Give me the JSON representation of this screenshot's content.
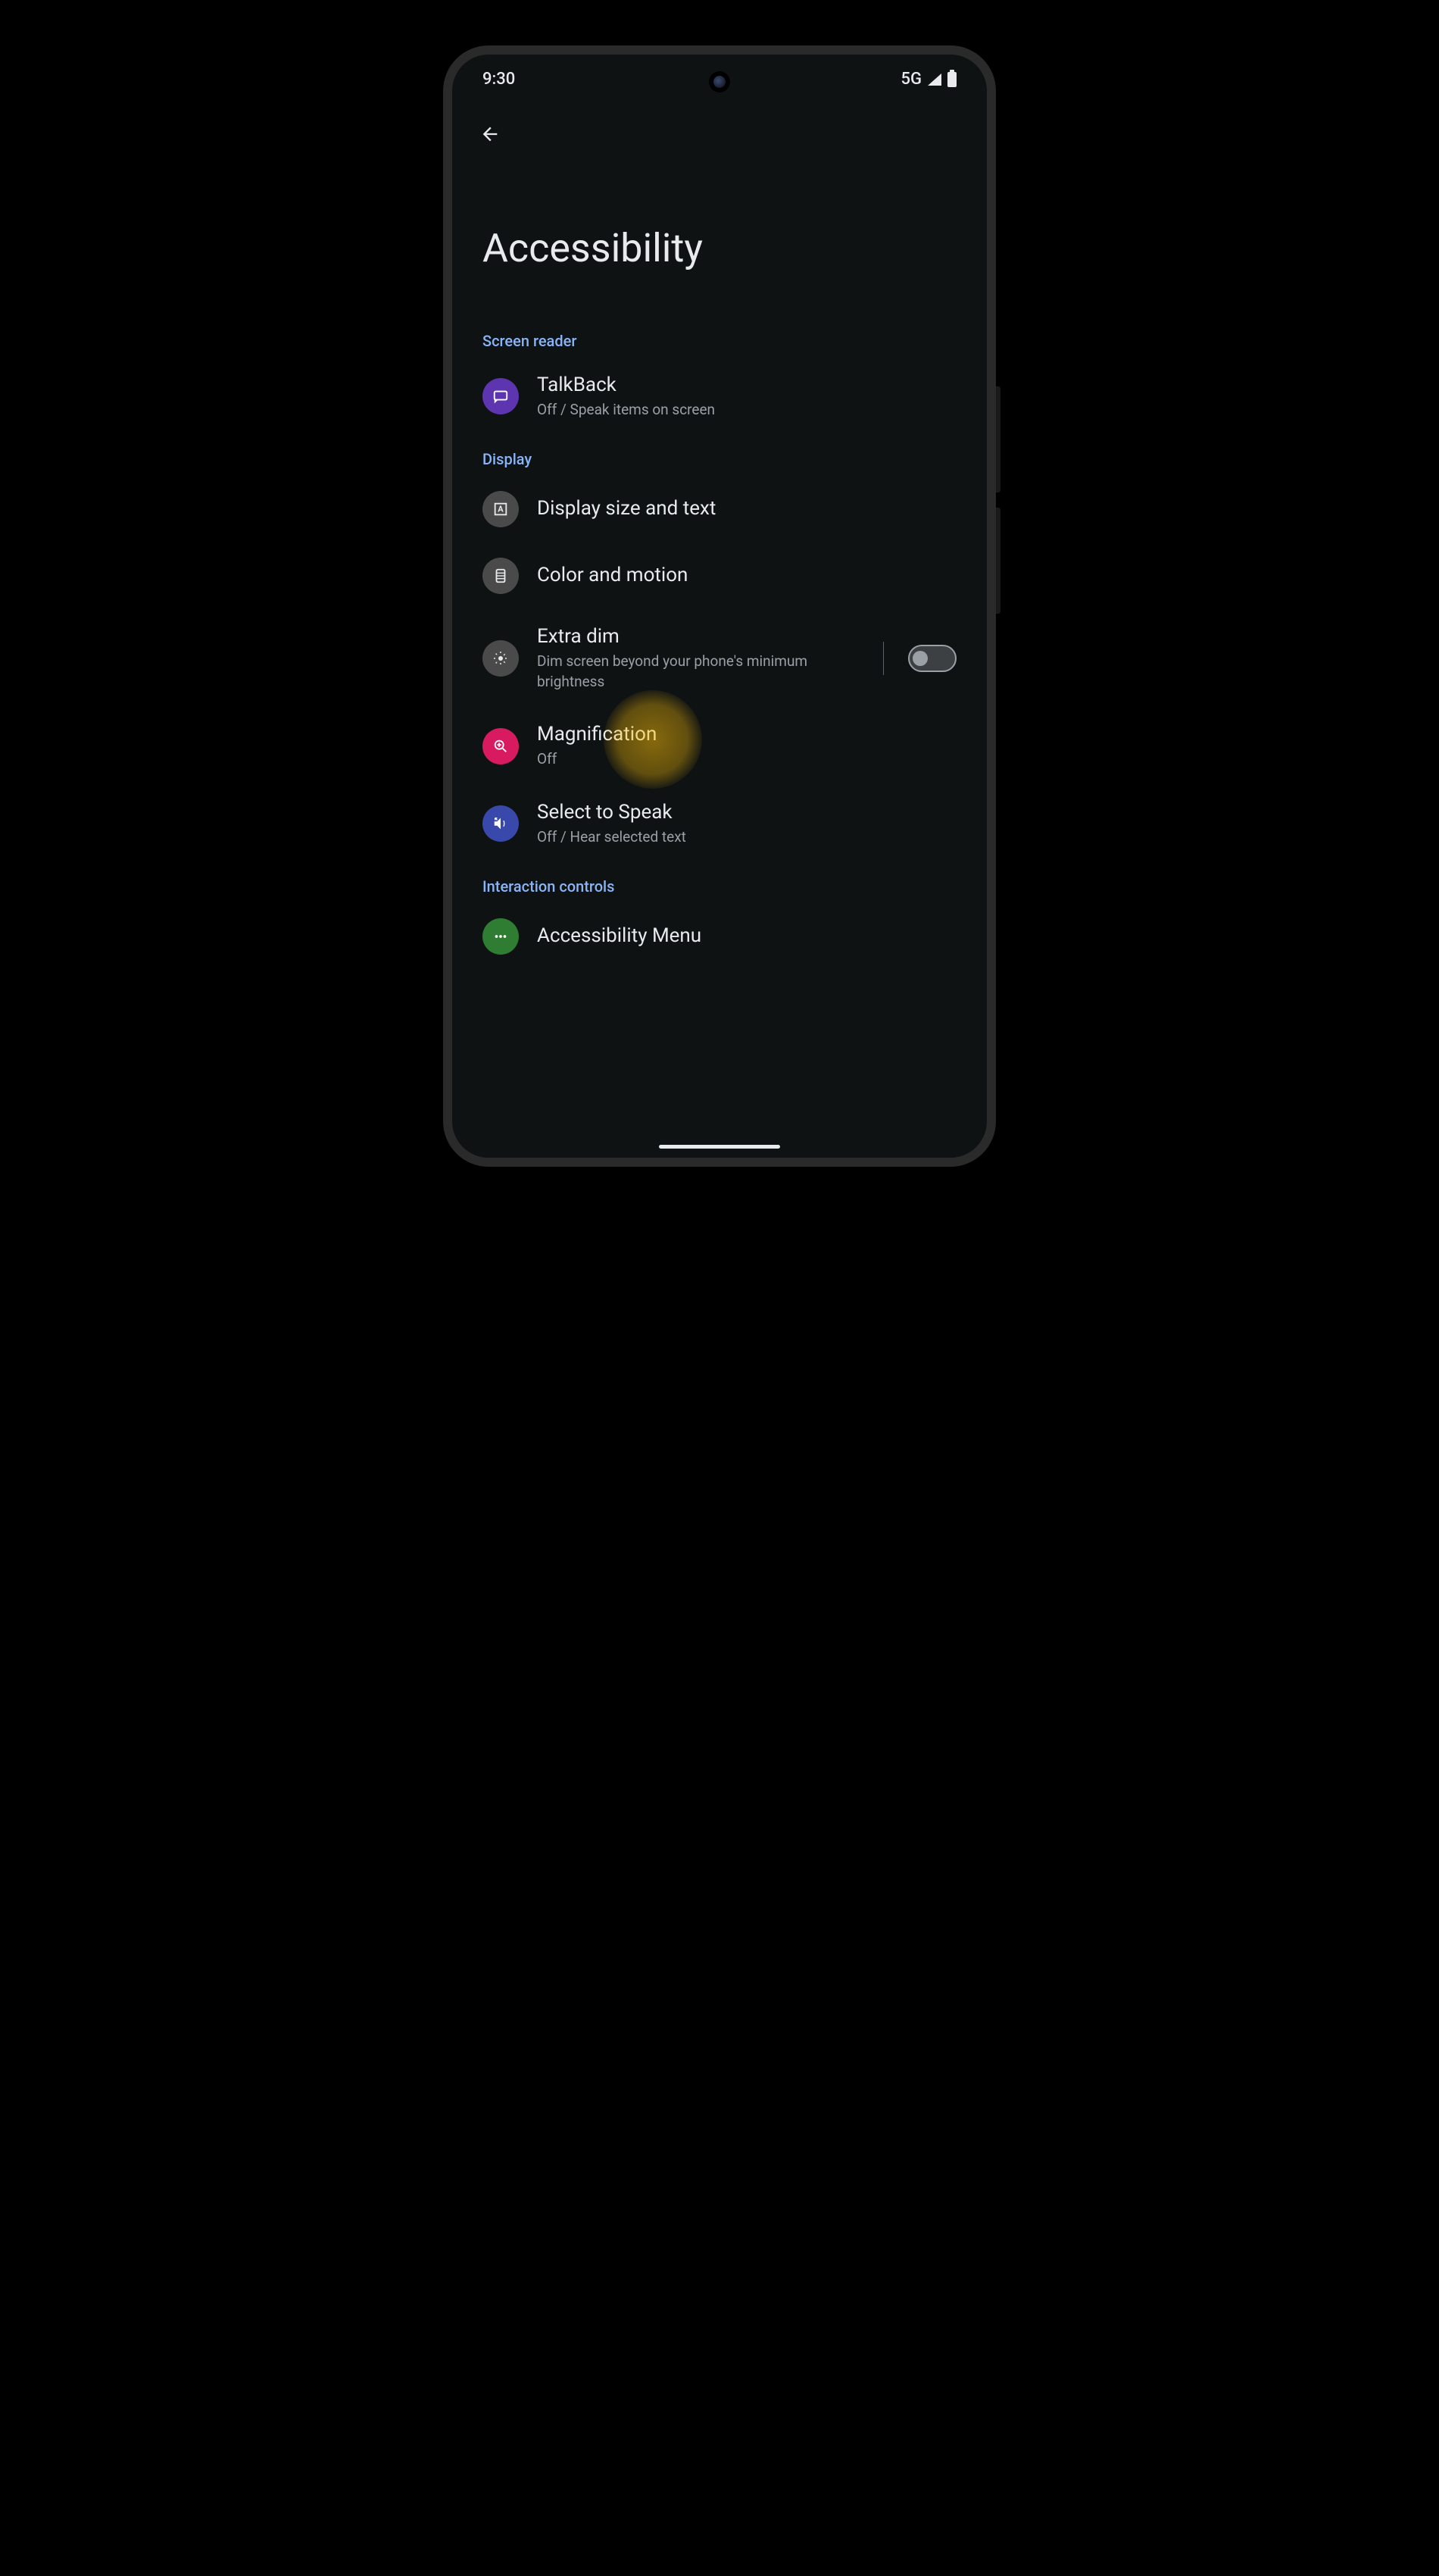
{
  "statusBar": {
    "time": "9:30",
    "network": "5G"
  },
  "pageTitle": "Accessibility",
  "sections": {
    "screenReader": {
      "header": "Screen reader",
      "talkback": {
        "title": "TalkBack",
        "subtitle": "Off / Speak items on screen"
      }
    },
    "display": {
      "header": "Display",
      "displaySize": {
        "title": "Display size and text"
      },
      "colorMotion": {
        "title": "Color and motion"
      },
      "extraDim": {
        "title": "Extra dim",
        "subtitle": "Dim screen beyond your phone's minimum brightness"
      },
      "magnification": {
        "title": "Magnification",
        "subtitle": "Off"
      },
      "selectToSpeak": {
        "title": "Select to Speak",
        "subtitle": "Off / Hear selected text"
      }
    },
    "interaction": {
      "header": "Interaction controls",
      "accessibilityMenu": {
        "title": "Accessibility Menu"
      }
    }
  }
}
